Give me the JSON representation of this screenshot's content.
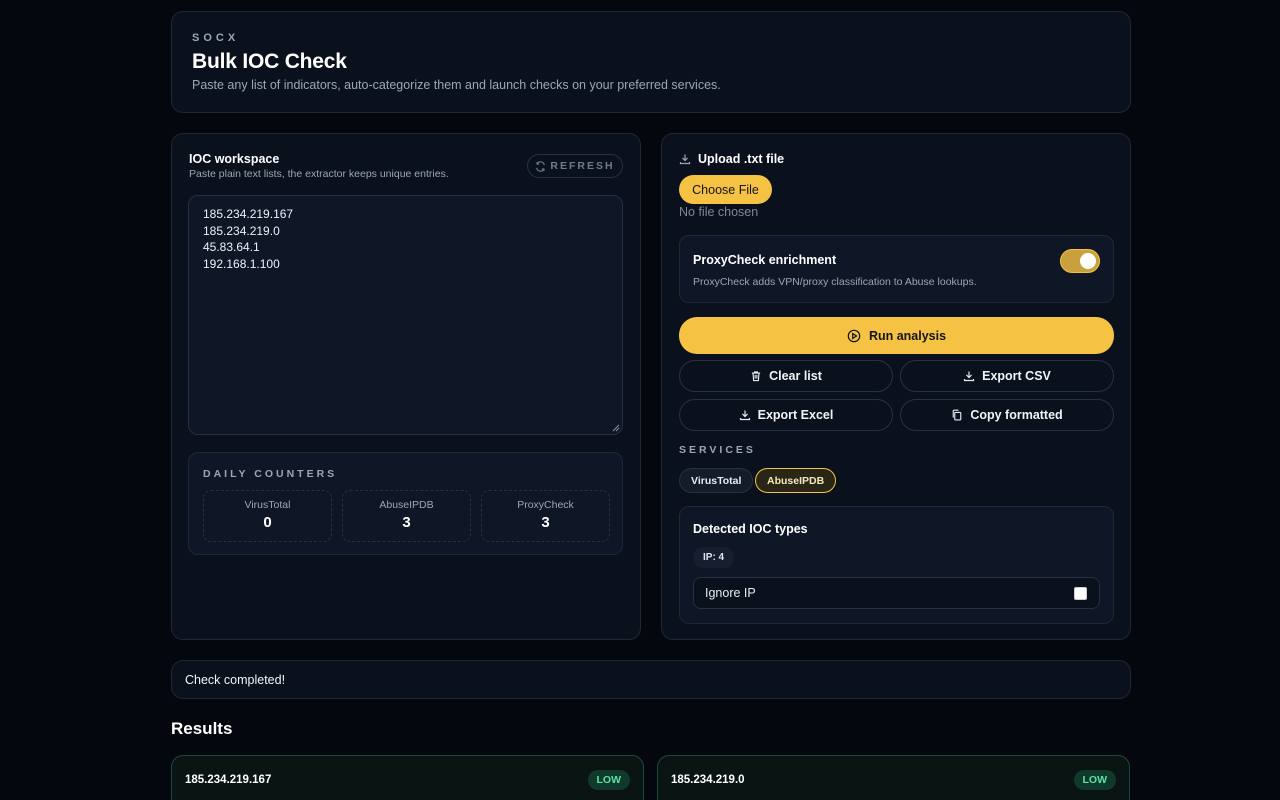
{
  "header": {
    "brand": "SOCX",
    "title": "Bulk IOC Check",
    "subtitle": "Paste any list of indicators, auto-categorize them and launch checks on your preferred services."
  },
  "workspace": {
    "title": "IOC workspace",
    "subtitle": "Paste plain text lists, the extractor keeps unique entries.",
    "refresh_label": "REFRESH",
    "ioc_text": "185.234.219.167\n185.234.219.0\n45.83.64.1\n192.168.1.100"
  },
  "counters": {
    "title": "DAILY COUNTERS",
    "items": [
      {
        "label": "VirusTotal",
        "value": "0"
      },
      {
        "label": "AbuseIPDB",
        "value": "3"
      },
      {
        "label": "ProxyCheck",
        "value": "3"
      }
    ]
  },
  "upload": {
    "label": "Upload .txt file",
    "choose_label": "Choose File",
    "no_file_text": "No file chosen"
  },
  "proxycheck": {
    "title": "ProxyCheck enrichment",
    "description": "ProxyCheck adds VPN/proxy classification to Abuse lookups.",
    "enabled": true
  },
  "actions": {
    "run": "Run analysis",
    "clear": "Clear list",
    "export_csv": "Export CSV",
    "export_excel": "Export Excel",
    "copy": "Copy formatted"
  },
  "services": {
    "label": "SERVICES",
    "items": [
      {
        "name": "VirusTotal",
        "selected": false
      },
      {
        "name": "AbuseIPDB",
        "selected": true
      }
    ]
  },
  "detected": {
    "title": "Detected IOC types",
    "pill": "IP: 4",
    "ignore_label": "Ignore IP",
    "ignore_checked": false
  },
  "status": {
    "message": "Check completed!"
  },
  "results": {
    "title": "Results",
    "items": [
      {
        "ip": "185.234.219.167",
        "risk": "LOW"
      },
      {
        "ip": "185.234.219.0",
        "risk": "LOW"
      }
    ]
  },
  "colors": {
    "accent": "#f5c243",
    "background": "#04070d",
    "panel": "#0b111c",
    "low_badge": "#5ee0a2"
  }
}
